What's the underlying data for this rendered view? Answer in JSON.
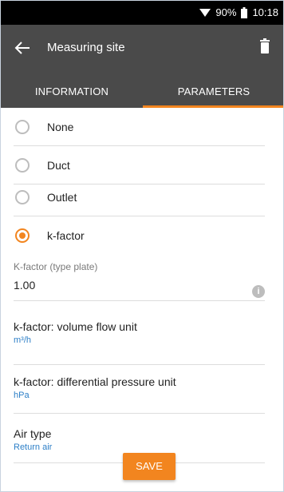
{
  "status": {
    "battery_percent": "90%",
    "time": "10:18"
  },
  "appbar": {
    "title": "Measuring site"
  },
  "tabs": [
    {
      "label": "INFORMATION"
    },
    {
      "label": "PARAMETERS"
    }
  ],
  "options": [
    {
      "label": "None",
      "selected": false
    },
    {
      "label": "Duct",
      "selected": false
    },
    {
      "label": "Outlet",
      "selected": false
    },
    {
      "label": "k-factor",
      "selected": true
    }
  ],
  "kfactor_field": {
    "label": "K-factor (type plate)",
    "value": "1.00"
  },
  "items": [
    {
      "title": "k-factor: volume flow unit",
      "value": "m³/h"
    },
    {
      "title": "k-factor: differential pressure unit",
      "value": "hPa"
    },
    {
      "title": "Air type",
      "value": "Return air"
    }
  ],
  "save_label": "SAVE",
  "colors": {
    "accent": "#f2851f",
    "appbar": "#4a4a4a",
    "link": "#2d7fc7"
  }
}
